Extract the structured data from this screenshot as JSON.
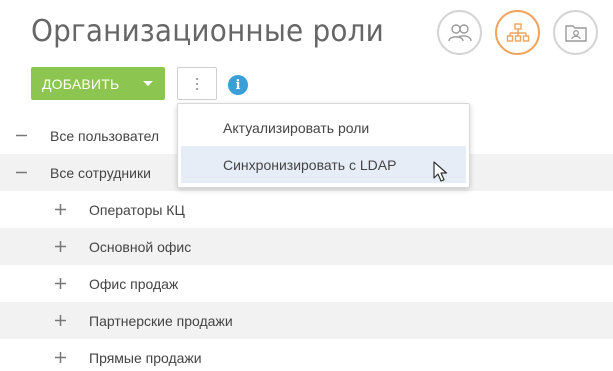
{
  "page": {
    "title": "Организационные роли"
  },
  "view_switcher": {
    "buttons": [
      {
        "icon": "users-icon",
        "active": false
      },
      {
        "icon": "org-structure-icon",
        "active": true
      },
      {
        "icon": "folder-user-icon",
        "active": false
      }
    ],
    "colors": {
      "active": "#f2a35a",
      "inactive": "#d4d4d4"
    }
  },
  "toolbar": {
    "add_label": "ДОБАВИТЬ",
    "add_color": "#8cc54f",
    "more_icon": "vertical-dots-icon",
    "info_icon": "info-icon",
    "info_label": "i",
    "info_color": "#3a9fd8"
  },
  "actions_menu": {
    "items": [
      {
        "label": "Актуализировать роли",
        "highlighted": false
      },
      {
        "label": "Синхронизировать с LDAP",
        "highlighted": true
      }
    ]
  },
  "tree": {
    "rows": [
      {
        "label": "Все пользовател",
        "toggle": "—",
        "level": 0
      },
      {
        "label": "Все сотрудники",
        "toggle": "—",
        "level": 0
      },
      {
        "label": "Операторы КЦ",
        "toggle": "+",
        "level": 1
      },
      {
        "label": "Основной офис",
        "toggle": "+",
        "level": 1
      },
      {
        "label": "Офис продаж",
        "toggle": "+",
        "level": 1
      },
      {
        "label": "Партнерские продажи",
        "toggle": "+",
        "level": 1
      },
      {
        "label": "Прямые продажи",
        "toggle": "+",
        "level": 1
      }
    ]
  }
}
